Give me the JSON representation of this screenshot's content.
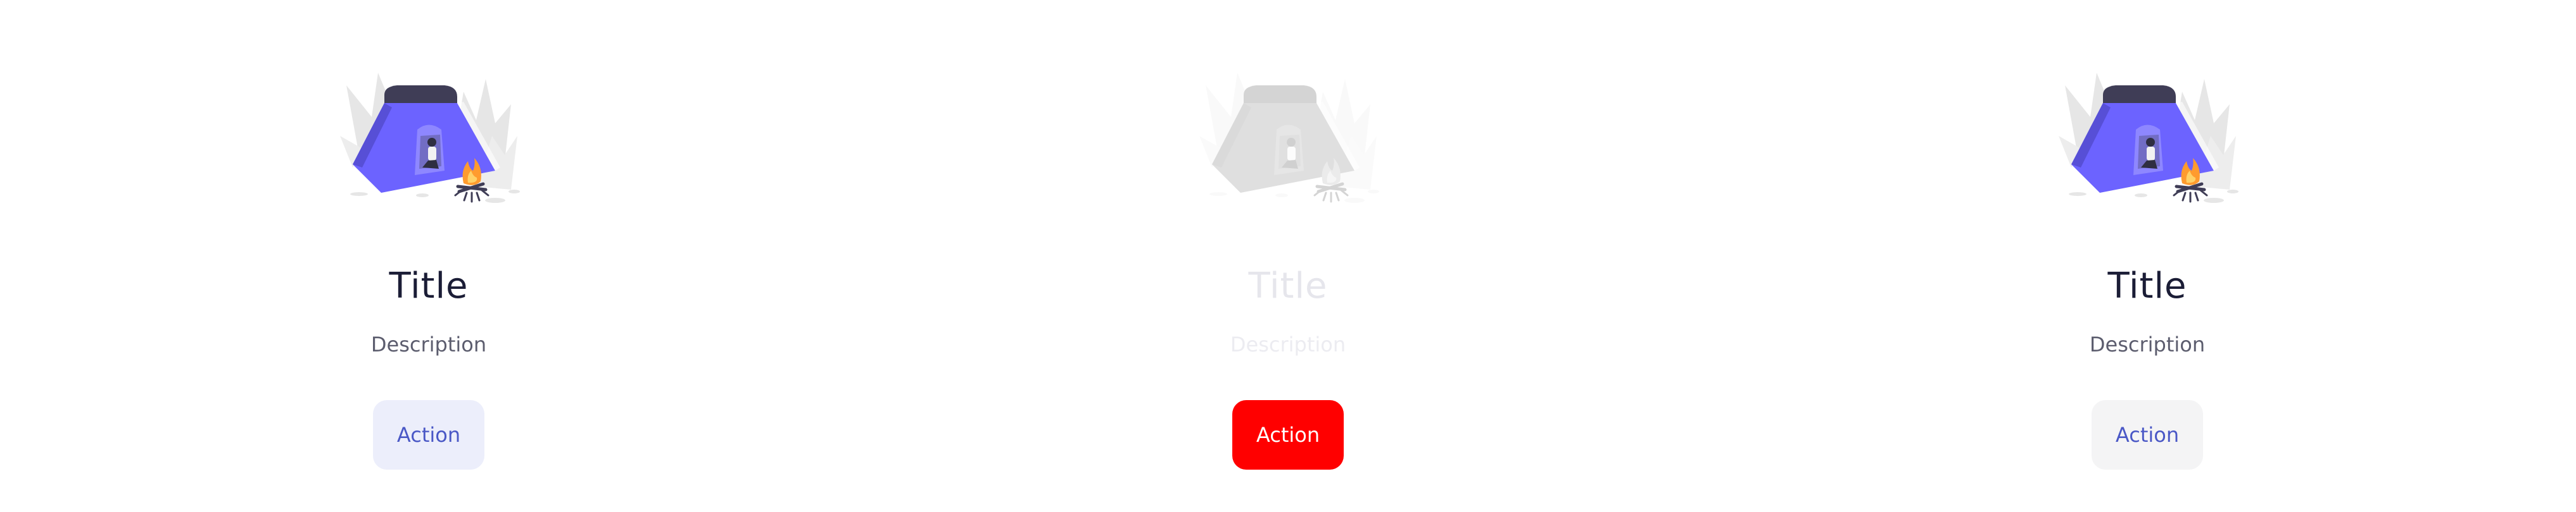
{
  "states": [
    {
      "illustration": "camping-tent-icon",
      "title": "Title",
      "description": "Description",
      "action_label": "Action",
      "button_bg": "#eceefb",
      "button_text_color": "#4a58c6"
    },
    {
      "illustration": "camping-tent-icon",
      "title": "Title",
      "description": "Description",
      "action_label": "Action",
      "button_bg": "#ff0000",
      "button_text_color": "#ffffff"
    },
    {
      "illustration": "camping-tent-icon",
      "title": "Title",
      "description": "Description",
      "action_label": "Action",
      "button_bg": "#f4f4f5",
      "button_text_color": "#4a58c6"
    }
  ],
  "colors": {
    "tent": "#6c63ff",
    "tent_top": "#3f3d56",
    "fire": "#ff9b2e",
    "foliage": "#e6e6e6",
    "title": "#1b1d36",
    "description": "#5c5d6e"
  }
}
